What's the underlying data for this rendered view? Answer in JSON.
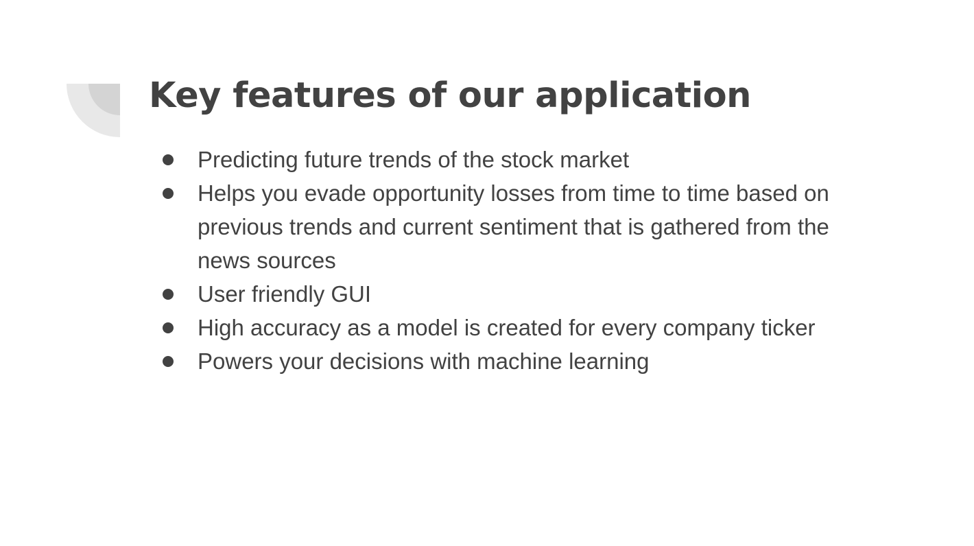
{
  "slide": {
    "title": "Key features of our application",
    "bullets": [
      "Predicting future trends of the stock market",
      "Helps you evade opportunity losses from time to time based on previous trends and current sentiment that is gathered from the news sources",
      "User friendly GUI",
      "High accuracy as a model is created for every company ticker",
      "Powers your decisions with machine learning"
    ]
  },
  "colors": {
    "text": "#424242",
    "background": "#ffffff",
    "decoration_light": "#e8e8e8",
    "decoration_dark": "#d4d4d4"
  },
  "icons": {
    "corner": "quarter-circle-decoration",
    "bullet": "bullet-dot-icon"
  }
}
